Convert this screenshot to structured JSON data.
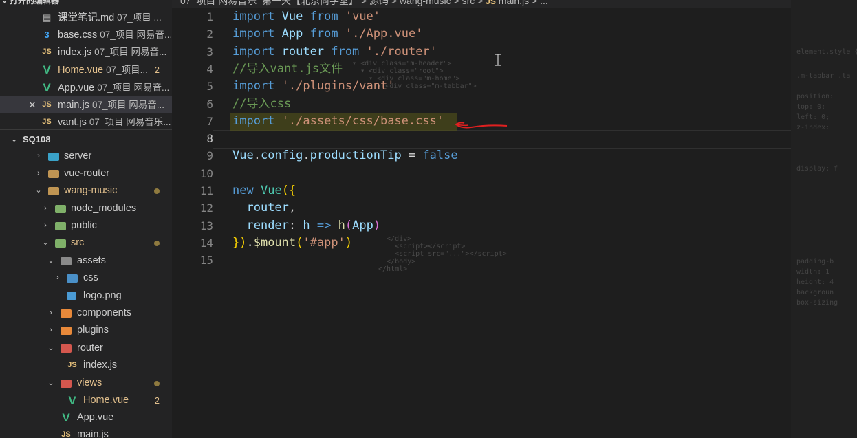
{
  "breadcrumb": {
    "path": "07_项目 网易音乐_第一天【北京尚学堂】 > 源码 > wang-music > src >",
    "js_badge": "JS",
    "file": "main.js > ..."
  },
  "open_editors": {
    "header": "打开的编辑器",
    "items": [
      {
        "icon": "markdown-icon",
        "glyph": "▤",
        "name": "课堂笔记.md",
        "desc": "07_项目 ..."
      },
      {
        "icon": "css-file-icon",
        "glyph": "3",
        "name": "base.css",
        "desc": "07_项目 网易音..."
      },
      {
        "icon": "js-file-icon",
        "glyph": "JS",
        "name": "index.js",
        "desc": "07_项目 网易音..."
      },
      {
        "icon": "vue-file-icon",
        "glyph": "V",
        "name": "Home.vue",
        "desc": "07_项目...",
        "badge": "2"
      },
      {
        "icon": "vue-file-icon",
        "glyph": "V",
        "name": "App.vue",
        "desc": "07_项目 网易音..."
      },
      {
        "icon": "js-file-icon",
        "glyph": "JS",
        "name": "main.js",
        "desc": "07_项目 网易音..."
      },
      {
        "icon": "js-file-icon",
        "glyph": "JS",
        "name": "vant.js",
        "desc": "07_项目 网易音乐..."
      }
    ],
    "close_glyph": "✕"
  },
  "explorer": {
    "root": "SQ108",
    "tree": {
      "server": "server",
      "vue_router": "vue-router",
      "wang_music": "wang-music",
      "node_modules": "node_modules",
      "public": "public",
      "src": "src",
      "assets": "assets",
      "css": "css",
      "logo": "logo.png",
      "components": "components",
      "plugins": "plugins",
      "router": "router",
      "router_index": "index.js",
      "views": "views",
      "home": "Home.vue",
      "home_badge": "2",
      "app": "App.vue",
      "main": "main.js",
      "js_glyph": "JS",
      "vue_glyph": "V"
    }
  },
  "editor": {
    "line_numbers": [
      "1",
      "2",
      "3",
      "4",
      "5",
      "6",
      "7",
      "8",
      "9",
      "10",
      "11",
      "12",
      "13",
      "14",
      "15"
    ],
    "code": {
      "l1": {
        "kw1": "import",
        "id": "Vue",
        "kw2": "from",
        "str": "'vue'"
      },
      "l2": {
        "kw1": "import",
        "id": "App",
        "kw2": "from",
        "str": "'./App.vue'"
      },
      "l3": {
        "kw1": "import",
        "id": "router",
        "kw2": "from",
        "str": "'./router'"
      },
      "l4": {
        "comment": "//导入vant.js文件"
      },
      "l5": {
        "kw1": "import",
        "str": "'./plugins/vant'"
      },
      "l6": {
        "comment": "//导入css"
      },
      "l7": {
        "kw1": "import",
        "str": "'./assets/css/base.css'"
      },
      "l9": {
        "obj": "Vue",
        "dot1": ".",
        "p1": "config",
        "dot2": ".",
        "p2": "productionTip",
        "eq": " = ",
        "val": "false"
      },
      "l11": {
        "kw": "new",
        "cls": "Vue",
        "open": "({"
      },
      "l12": {
        "id": "router",
        "comma": ","
      },
      "l13": {
        "id": "render",
        "colon": ": ",
        "h": "h",
        "arrow": " => ",
        "fn": "h",
        "paren1": "(",
        "arg": "App",
        "paren2": ")"
      },
      "l14": {
        "close": "})",
        "dot": ".",
        "fn": "$mount",
        "p1": "(",
        "str": "'#app'",
        "p2": ")"
      }
    }
  },
  "colors": {
    "editor_bg": "#1e1e1e",
    "sidebar_bg": "#232324",
    "keyword": "#569cd6",
    "string": "#ce9178",
    "comment": "#6a9955",
    "annotation": "#e02020"
  }
}
